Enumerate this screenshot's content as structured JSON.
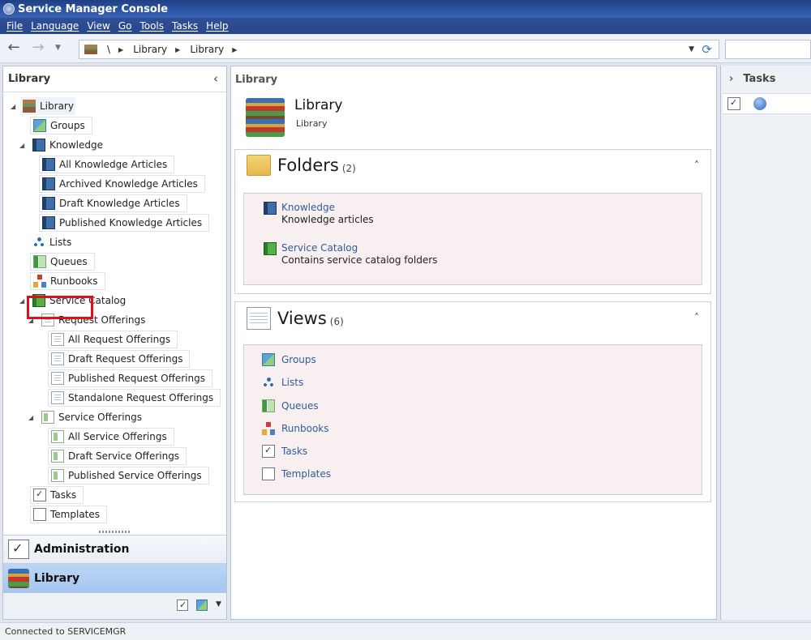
{
  "window": {
    "title": "Service Manager Console"
  },
  "menu": [
    "File",
    "Language",
    "View",
    "Go",
    "Tools",
    "Tasks",
    "Help"
  ],
  "address": {
    "root": "\\",
    "crumbs": [
      "Library",
      "Library"
    ]
  },
  "nav_pane": {
    "title": "Library",
    "tree": {
      "library": "Library",
      "groups": "Groups",
      "knowledge": "Knowledge",
      "all_ka": "All Knowledge Articles",
      "archived_ka": "Archived Knowledge Articles",
      "draft_ka": "Draft Knowledge Articles",
      "published_ka": "Published Knowledge Articles",
      "lists": "Lists",
      "queues": "Queues",
      "runbooks": "Runbooks",
      "service_catalog": "Service Catalog",
      "request_offerings": "Request Offerings",
      "all_ro": "All Request Offerings",
      "draft_ro": "Draft Request Offerings",
      "published_ro": "Published Request Offerings",
      "standalone_ro": "Standalone Request Offerings",
      "service_offerings": "Service Offerings",
      "all_so": "All Service Offerings",
      "draft_so": "Draft Service Offerings",
      "published_so": "Published Service Offerings",
      "tasks": "Tasks",
      "templates": "Templates"
    },
    "workspaces": {
      "administration": "Administration",
      "library": "Library"
    }
  },
  "content": {
    "header": "Library",
    "title": "Library",
    "subtitle": "Library",
    "folders": {
      "title": "Folders",
      "count": "(2)",
      "items": [
        {
          "name": "Knowledge",
          "description": "Knowledge articles"
        },
        {
          "name": "Service Catalog",
          "description": "Contains service catalog folders"
        }
      ]
    },
    "views": {
      "title": "Views",
      "count": "(6)",
      "items": [
        "Groups",
        "Lists",
        "Queues",
        "Runbooks",
        "Tasks",
        "Templates"
      ]
    }
  },
  "tasks_pane": {
    "title": "Tasks"
  },
  "status": {
    "text": "Connected to SERVICEMGR"
  },
  "colors": {
    "highlight": "#e0101a",
    "selected_workspace": "#a6c6ef",
    "link": "#2f5d96"
  }
}
